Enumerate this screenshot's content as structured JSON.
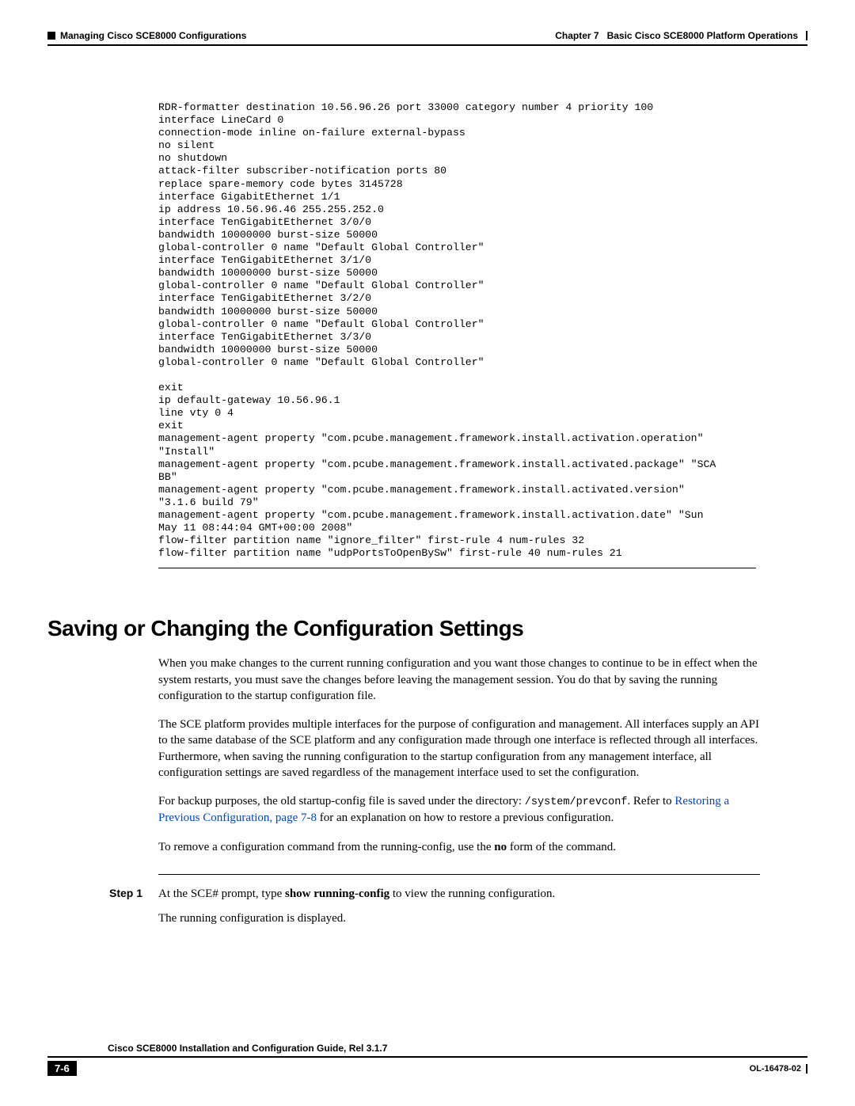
{
  "header": {
    "section_title": "Managing Cisco SCE8000 Configurations",
    "chapter_label": "Chapter 7",
    "chapter_title": "Basic Cisco SCE8000 Platform Operations"
  },
  "code": "RDR-formatter destination 10.56.96.26 port 33000 category number 4 priority 100\ninterface LineCard 0\nconnection-mode inline on-failure external-bypass\nno silent\nno shutdown\nattack-filter subscriber-notification ports 80\nreplace spare-memory code bytes 3145728\ninterface GigabitEthernet 1/1\nip address 10.56.96.46 255.255.252.0\ninterface TenGigabitEthernet 3/0/0\nbandwidth 10000000 burst-size 50000\nglobal-controller 0 name \"Default Global Controller\"\ninterface TenGigabitEthernet 3/1/0\nbandwidth 10000000 burst-size 50000\nglobal-controller 0 name \"Default Global Controller\"\ninterface TenGigabitEthernet 3/2/0\nbandwidth 10000000 burst-size 50000\nglobal-controller 0 name \"Default Global Controller\"\ninterface TenGigabitEthernet 3/3/0\nbandwidth 10000000 burst-size 50000\nglobal-controller 0 name \"Default Global Controller\"\n\nexit\nip default-gateway 10.56.96.1\nline vty 0 4\nexit\nmanagement-agent property \"com.pcube.management.framework.install.activation.operation\" \n\"Install\"\nmanagement-agent property \"com.pcube.management.framework.install.activated.package\" \"SCA \nBB\"\nmanagement-agent property \"com.pcube.management.framework.install.activated.version\" \n\"3.1.6 build 79\"\nmanagement-agent property \"com.pcube.management.framework.install.activation.date\" \"Sun \nMay 11 08:44:04 GMT+00:00 2008\"\nflow-filter partition name \"ignore_filter\" first-rule 4 num-rules 32\nflow-filter partition name \"udpPortsToOpenBySw\" first-rule 40 num-rules 21",
  "section": {
    "heading": "Saving or Changing the Configuration Settings",
    "para1": "When you make changes to the current running configuration and you want those changes to continue to be in effect when the system restarts, you must save the changes before leaving the management session. You do that by saving the running configuration to the startup configuration file.",
    "para2": "The SCE platform provides multiple interfaces for the purpose of configuration and management. All interfaces supply an API to the same database of the SCE platform and any configuration made through one interface is reflected through all interfaces. Furthermore, when saving the running configuration to the startup configuration from any management interface, all configuration settings are saved regardless of the management interface used to set the configuration.",
    "para3_pre": "For backup purposes, the old startup-config file is saved under the directory: ",
    "para3_path": "/system/prevconf",
    "para3_mid": ". Refer to ",
    "para3_link": "Restoring a Previous Configuration, page 7-8",
    "para3_post": " for an explanation on how to restore a previous configuration.",
    "para4_pre": "To remove a configuration command from the running-config, use the ",
    "para4_bold": "no",
    "para4_post": " form of the command."
  },
  "step1": {
    "label": "Step 1",
    "line1_pre": "At the SCE# prompt, type ",
    "line1_bold": "show running-config",
    "line1_post": " to view the running configuration.",
    "line2": "The running configuration is displayed."
  },
  "footer": {
    "guide_title": "Cisco SCE8000 Installation and Configuration Guide, Rel 3.1.7",
    "page_num": "7-6",
    "doc_id": "OL-16478-02"
  }
}
